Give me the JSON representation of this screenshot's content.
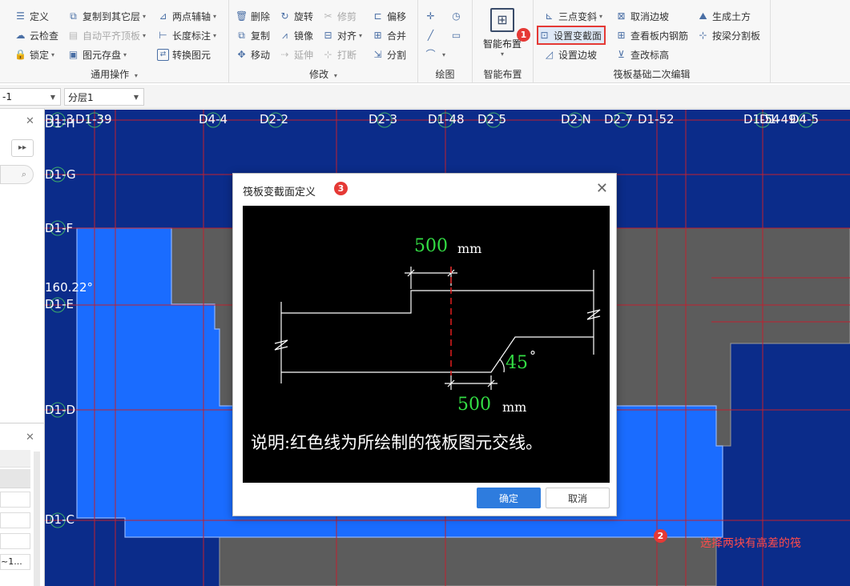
{
  "ribbon": {
    "general": {
      "label": "通用操作",
      "items": {
        "define": "定义",
        "copy_to_layer": "复制到其它层",
        "two_point_axis": "两点辅轴",
        "cloud_check": "云检查",
        "auto_align_top": "自动平齐顶板",
        "length_dim": "长度标注",
        "lock": "锁定",
        "element_save": "图元存盘",
        "convert_element": "转换图元"
      }
    },
    "modify": {
      "label": "修改",
      "items": {
        "delete": "删除",
        "rotate": "旋转",
        "trim": "修剪",
        "offset": "偏移",
        "copy": "复制",
        "mirror": "镜像",
        "align": "对齐",
        "merge": "合并",
        "move": "移动",
        "extend": "延伸",
        "break": "打断",
        "split": "分割"
      }
    },
    "draw": {
      "label": "绘图"
    },
    "smart": {
      "label": "智能布置",
      "button": "智能布置"
    },
    "raft": {
      "label": "筏板基础二次编辑",
      "items": {
        "three_point_slope": "三点变斜",
        "cancel_edge_slope": "取消边坡",
        "generate_earthwork": "生成土方",
        "set_section_change": "设置变截面",
        "view_rebar": "查看板内钢筋",
        "split_by_beam": "按梁分割板",
        "set_edge_slope": "设置边坡",
        "check_elevation": "查改标高"
      }
    }
  },
  "layer_bar": {
    "floor": "-1",
    "layer": "分层1"
  },
  "canvas": {
    "axes_top": [
      "D1-39",
      "D4-4",
      "D2-2",
      "D2-3",
      "D1-48",
      "D2-5",
      "D2-N",
      "D2-7",
      "D1-52",
      "D1-54",
      "D1-49",
      "D4-5"
    ],
    "axis_top_left": "D1-3",
    "axes_left": [
      "D1-H",
      "D1-G",
      "D1-F",
      "D1-E",
      "D1-D",
      "D1-C"
    ],
    "angle": "160.22°",
    "note_step2": "选择两块有高差的筏",
    "colors": {
      "background": "#0b2c8a",
      "slab_blue": "#1a6cff",
      "slab_gray": "#5a5a5a",
      "grid_red": "#c0202f"
    }
  },
  "badges": {
    "step1": "1",
    "step2": "2",
    "step3": "3"
  },
  "dialog": {
    "title": "筏板变截面定义",
    "top_dim": "500",
    "top_unit": "mm",
    "bottom_dim": "500",
    "bottom_unit": "mm",
    "angle": "45",
    "degree": "°",
    "description": "说明:红色线为所绘制的筏板图元交线。",
    "ok": "确定",
    "cancel": "取消"
  }
}
